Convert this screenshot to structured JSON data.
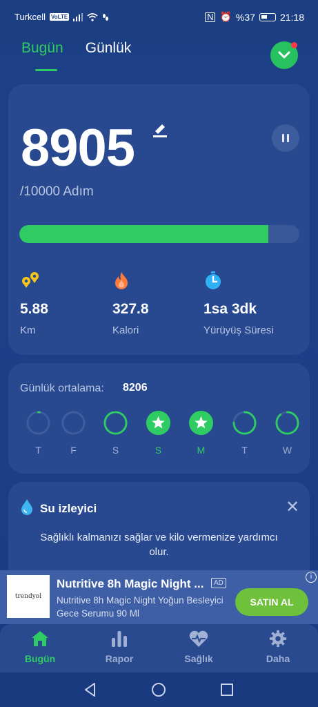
{
  "status_bar": {
    "carrier": "Turkcell",
    "volte": "VoLTE",
    "battery": "%37",
    "time": "21:18"
  },
  "tabs": {
    "today": "Bugün",
    "daily": "Günlük"
  },
  "steps": {
    "count": "8905",
    "goal_label": "/10000 Adım",
    "progress": 0.89
  },
  "stats": [
    {
      "icon": "location-pin-icon",
      "value": "5.88",
      "label": "Km",
      "color": "#f5c518"
    },
    {
      "icon": "flame-icon",
      "value": "327.8",
      "label": "Kalori",
      "color": "#ff7a3d"
    },
    {
      "icon": "stopwatch-icon",
      "value": "1sa 3dk",
      "label": "Yürüyüş Süresi",
      "color": "#2fb2f5"
    }
  ],
  "average": {
    "label": "Günlük ortalama:",
    "value": "8206",
    "days": [
      {
        "label": "T",
        "progress": 0.02,
        "goal_met": false
      },
      {
        "label": "F",
        "progress": 0,
        "goal_met": false
      },
      {
        "label": "S",
        "progress": 0.97,
        "goal_met": false
      },
      {
        "label": "S",
        "progress": 1,
        "goal_met": true
      },
      {
        "label": "M",
        "progress": 1,
        "goal_met": true
      },
      {
        "label": "T",
        "progress": 0.75,
        "goal_met": false
      },
      {
        "label": "W",
        "progress": 0.89,
        "goal_met": false
      }
    ]
  },
  "water": {
    "title": "Su izleyici",
    "text": "Sağlıklı kalmanızı sağlar ve kilo vermenize yardımcı olur."
  },
  "ad": {
    "title": "Nutritive 8h Magic Night ...",
    "badge": "AD",
    "description": "Nutritive 8h Magic Night Yoğun Besleyici Gece Serumu 90 Ml",
    "cta": "SATIN AL",
    "logo_text": "trendyol"
  },
  "nav": {
    "today": "Bugün",
    "report": "Rapor",
    "health": "Sağlık",
    "more": "Daha"
  },
  "colors": {
    "accent": "#2ecc63",
    "card": "#28498f",
    "background": "#1c3f84"
  }
}
